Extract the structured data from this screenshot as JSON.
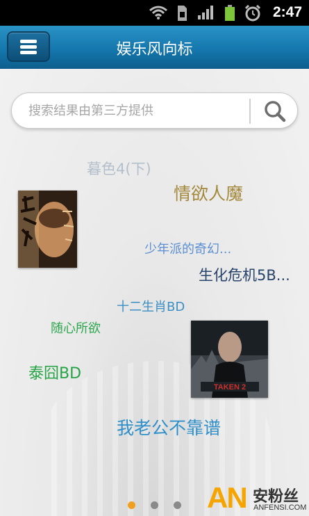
{
  "status_bar": {
    "time": "2:47",
    "icons": [
      "wifi-icon",
      "sim-icon",
      "signal-icon",
      "battery-icon",
      "alarm-icon"
    ]
  },
  "header": {
    "title": "娱乐风向标",
    "menu_icon": "hamburger-menu-icon"
  },
  "search": {
    "placeholder": "搜索结果由第三方提供",
    "value": "",
    "button_icon": "search-icon"
  },
  "tags": [
    {
      "label": "暮色4(下)",
      "color": "#b3bfca"
    },
    {
      "label": "情欲人魔",
      "color": "#a3893c"
    },
    {
      "label": "少年派的奇幻...",
      "color": "#5b8fd2"
    },
    {
      "label": "生化危机5B...",
      "color": "#27436a"
    },
    {
      "label": "十二生肖BD",
      "color": "#3b8fc4"
    },
    {
      "label": "随心所欲",
      "color": "#2ea64e"
    },
    {
      "label": "泰囧BD",
      "color": "#26a345"
    },
    {
      "label": "我老公不靠谱",
      "color": "#2f8fc8"
    }
  ],
  "posters": [
    {
      "name": "poster-shanghai",
      "title": "上海"
    },
    {
      "name": "poster-taken2",
      "title": "TAKEN 2"
    }
  ],
  "pager": {
    "pages": 3,
    "current": 1,
    "active_color": "#f0a020",
    "inactive_color": "#8a8a8a"
  },
  "watermark": {
    "logo": "AN",
    "cn": "安粉丝",
    "en": "ANFENSI.COM"
  }
}
